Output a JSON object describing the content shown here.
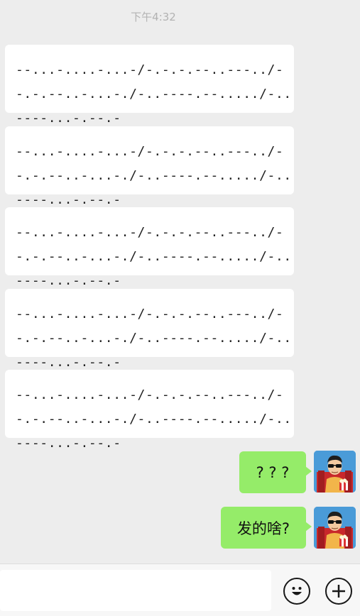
{
  "timestamp": "下午4:32",
  "messages_incoming": [
    {
      "text": "--...-....-...-/-.-.-.--..---../--.-.--..-...-./-..----.--...../-..----...-.--.-"
    },
    {
      "text": "--...-....-...-/-.-.-.--..---../--.-.--..-...-./-..----.--...../-..----...-.--.-"
    },
    {
      "text": "--...-....-...-/-.-.-.--..---../--.-.--..-...-./-..----.--...../-..----...-.--.-"
    },
    {
      "text": "--...-....-...-/-.-.-.--..---../--.-.--..-...-./-..----.--...../-..----...-.--.-"
    },
    {
      "text": "--...-....-...-/-.-.-.--..---../--.-.--..-...-./-..----.--...../-..----...-.--.-"
    }
  ],
  "messages_outgoing": [
    {
      "text": "? ? ?"
    },
    {
      "text": "发的啥?"
    }
  ],
  "input": {
    "value": "",
    "placeholder": ""
  },
  "icons": {
    "emoji": "emoji-icon",
    "plus": "plus-icon"
  },
  "colors": {
    "background": "#ededed",
    "outgoing_bubble": "#95ec69",
    "incoming_bubble": "#ffffff"
  }
}
